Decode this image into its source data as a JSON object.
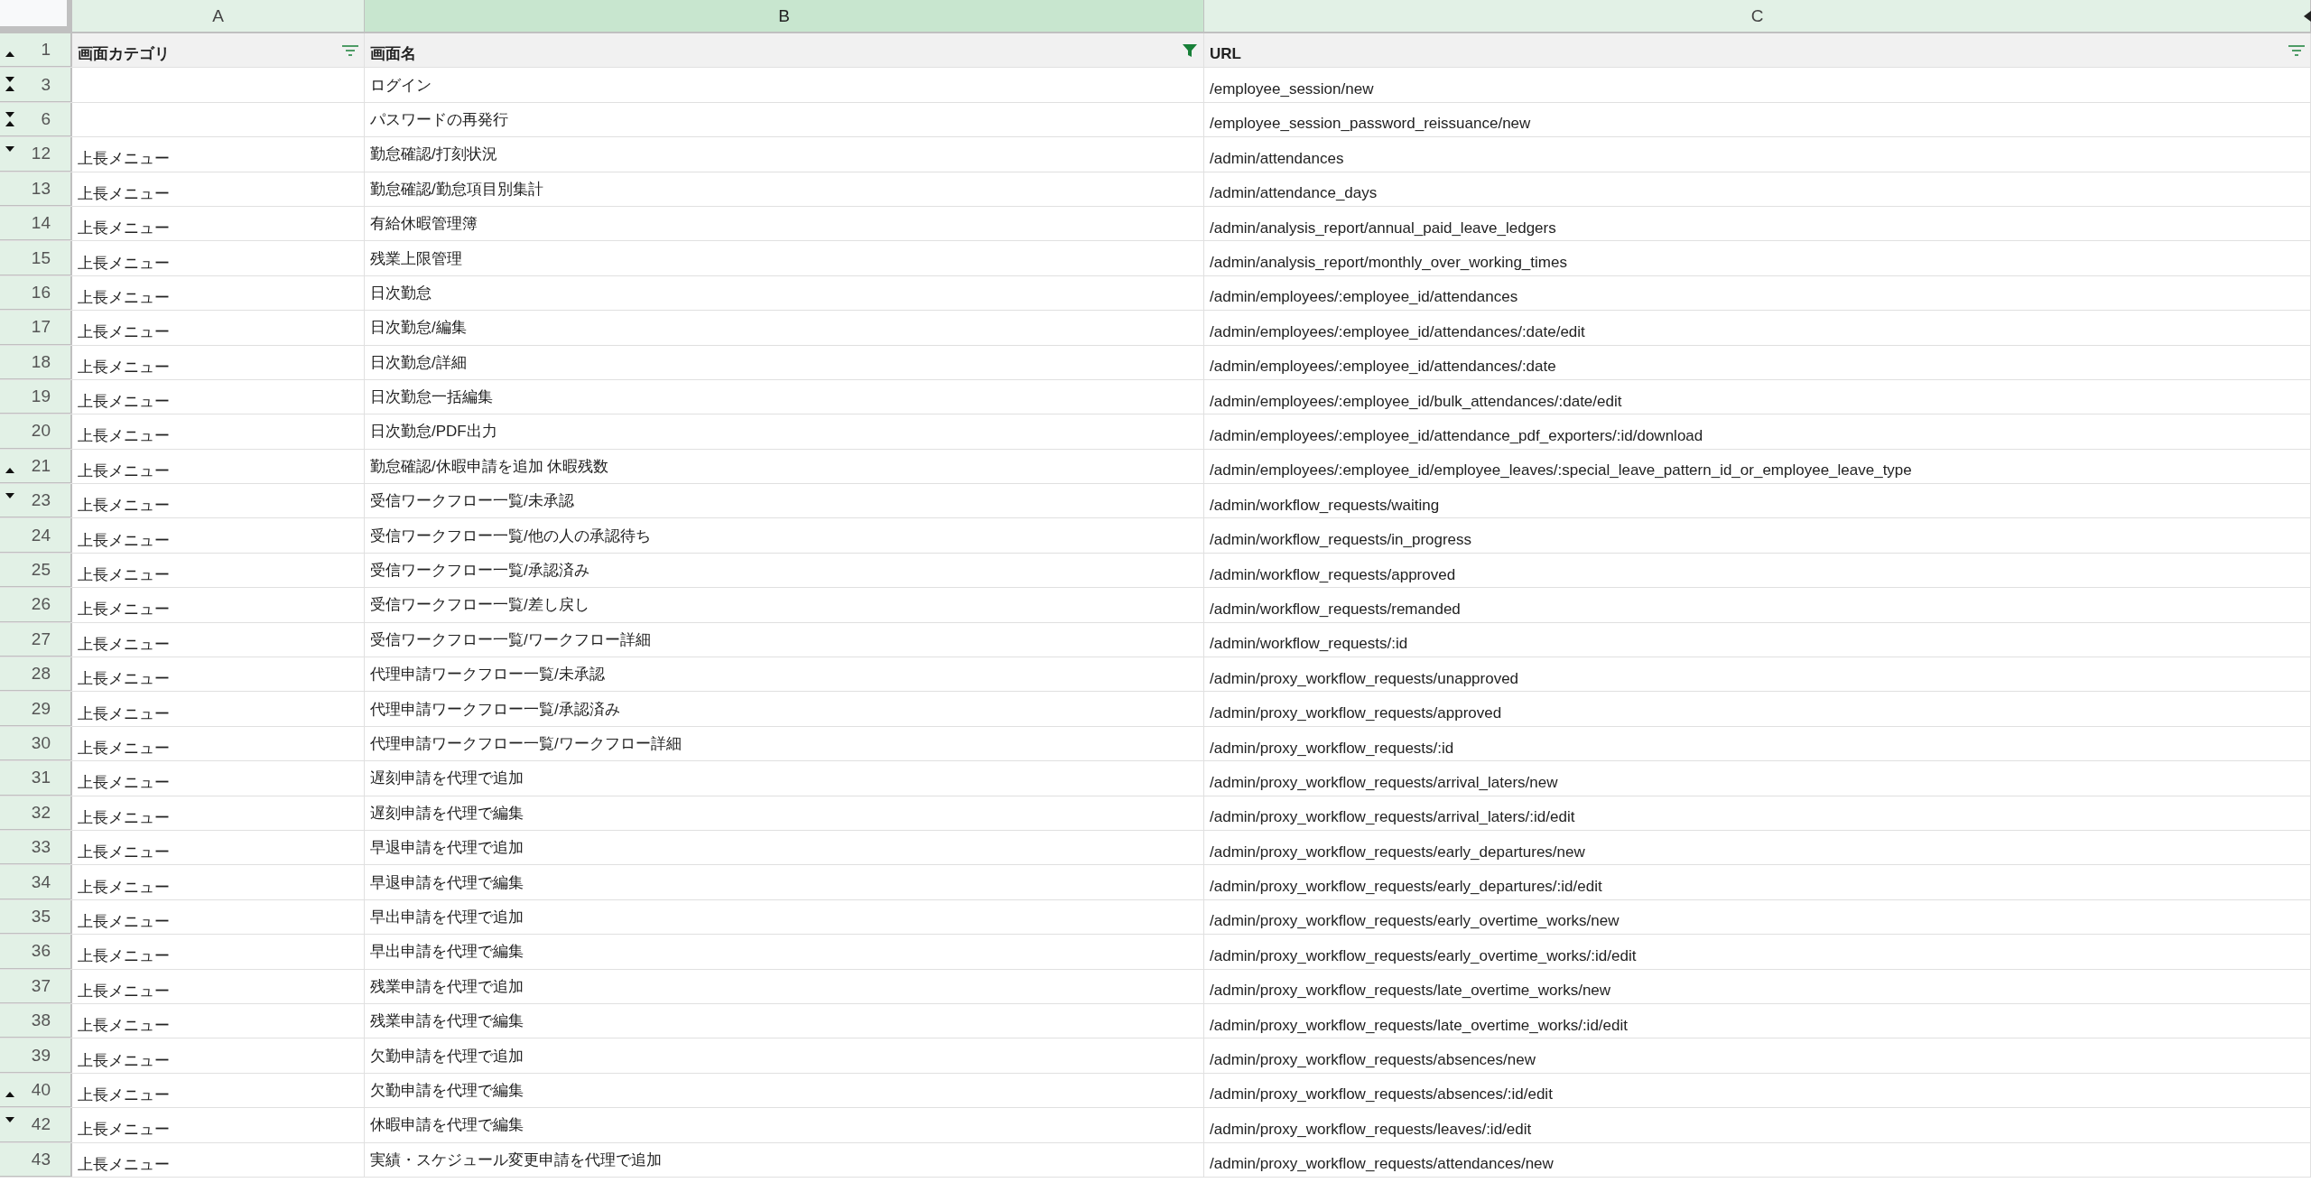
{
  "columns": [
    {
      "letter": "A",
      "selected": false
    },
    {
      "letter": "B",
      "selected": true
    },
    {
      "letter": "C",
      "selected": false
    }
  ],
  "header_row": {
    "number": "1",
    "arrow_up": true,
    "arrow_down": false,
    "cells": [
      {
        "text": "画面カテゴリ",
        "filter_active": false
      },
      {
        "text": "画面名",
        "filter_active": true
      },
      {
        "text": "URL",
        "filter_active": false
      }
    ]
  },
  "rows": [
    {
      "number": "3",
      "arrow_up": true,
      "arrow_down": true,
      "screen": "ログイン",
      "url": "/employee_session/new"
    },
    {
      "number": "6",
      "arrow_up": true,
      "arrow_down": true,
      "screen": "パスワードの再発行",
      "url": "/employee_session_password_reissuance/new"
    },
    {
      "number": "12",
      "arrow_up": false,
      "arrow_down": true,
      "category": "上長メニュー",
      "screen": "勤怠確認/打刻状況",
      "url": "/admin/attendances"
    },
    {
      "number": "13",
      "category": "上長メニュー",
      "screen": "勤怠確認/勤怠項目別集計",
      "url": "/admin/attendance_days"
    },
    {
      "number": "14",
      "category": "上長メニュー",
      "screen": "有給休暇管理簿",
      "url": "/admin/analysis_report/annual_paid_leave_ledgers"
    },
    {
      "number": "15",
      "category": "上長メニュー",
      "screen": "残業上限管理",
      "url": "/admin/analysis_report/monthly_over_working_times"
    },
    {
      "number": "16",
      "category": "上長メニュー",
      "screen": "日次勤怠",
      "url": "/admin/employees/:employee_id/attendances"
    },
    {
      "number": "17",
      "category": "上長メニュー",
      "screen": "日次勤怠/編集",
      "url": "/admin/employees/:employee_id/attendances/:date/edit"
    },
    {
      "number": "18",
      "category": "上長メニュー",
      "screen": "日次勤怠/詳細",
      "url": "/admin/employees/:employee_id/attendances/:date"
    },
    {
      "number": "19",
      "category": "上長メニュー",
      "screen": "日次勤怠一括編集",
      "url": "/admin/employees/:employee_id/bulk_attendances/:date/edit"
    },
    {
      "number": "20",
      "category": "上長メニュー",
      "screen": "日次勤怠/PDF出力",
      "url": "/admin/employees/:employee_id/attendance_pdf_exporters/:id/download"
    },
    {
      "number": "21",
      "arrow_up": true,
      "arrow_down": false,
      "category": "上長メニュー",
      "screen": "勤怠確認/休暇申請を追加 休暇残数",
      "url": "/admin/employees/:employee_id/employee_leaves/:special_leave_pattern_id_or_employee_leave_type"
    },
    {
      "number": "23",
      "arrow_up": false,
      "arrow_down": true,
      "category": "上長メニュー",
      "screen": "受信ワークフロー一覧/未承認",
      "url": "/admin/workflow_requests/waiting"
    },
    {
      "number": "24",
      "category": "上長メニュー",
      "screen": "受信ワークフロー一覧/他の人の承認待ち",
      "url": "/admin/workflow_requests/in_progress"
    },
    {
      "number": "25",
      "category": "上長メニュー",
      "screen": "受信ワークフロー一覧/承認済み",
      "url": "/admin/workflow_requests/approved"
    },
    {
      "number": "26",
      "category": "上長メニュー",
      "screen": "受信ワークフロー一覧/差し戻し",
      "url": "/admin/workflow_requests/remanded"
    },
    {
      "number": "27",
      "category": "上長メニュー",
      "screen": "受信ワークフロー一覧/ワークフロー詳細",
      "url": "/admin/workflow_requests/:id"
    },
    {
      "number": "28",
      "category": "上長メニュー",
      "screen": "代理申請ワークフロー一覧/未承認",
      "url": "/admin/proxy_workflow_requests/unapproved"
    },
    {
      "number": "29",
      "category": "上長メニュー",
      "screen": "代理申請ワークフロー一覧/承認済み",
      "url": "/admin/proxy_workflow_requests/approved"
    },
    {
      "number": "30",
      "category": "上長メニュー",
      "screen": "代理申請ワークフロー一覧/ワークフロー詳細",
      "url": "/admin/proxy_workflow_requests/:id"
    },
    {
      "number": "31",
      "category": "上長メニュー",
      "screen": "遅刻申請を代理で追加",
      "url": "/admin/proxy_workflow_requests/arrival_laters/new"
    },
    {
      "number": "32",
      "category": "上長メニュー",
      "screen": "遅刻申請を代理で編集",
      "url": "/admin/proxy_workflow_requests/arrival_laters/:id/edit"
    },
    {
      "number": "33",
      "category": "上長メニュー",
      "screen": "早退申請を代理で追加",
      "url": "/admin/proxy_workflow_requests/early_departures/new"
    },
    {
      "number": "34",
      "category": "上長メニュー",
      "screen": "早退申請を代理で編集",
      "url": "/admin/proxy_workflow_requests/early_departures/:id/edit"
    },
    {
      "number": "35",
      "category": "上長メニュー",
      "screen": "早出申請を代理で追加",
      "url": "/admin/proxy_workflow_requests/early_overtime_works/new"
    },
    {
      "number": "36",
      "category": "上長メニュー",
      "screen": "早出申請を代理で編集",
      "url": "/admin/proxy_workflow_requests/early_overtime_works/:id/edit"
    },
    {
      "number": "37",
      "category": "上長メニュー",
      "screen": "残業申請を代理で追加",
      "url": "/admin/proxy_workflow_requests/late_overtime_works/new"
    },
    {
      "number": "38",
      "category": "上長メニュー",
      "screen": "残業申請を代理で編集",
      "url": "/admin/proxy_workflow_requests/late_overtime_works/:id/edit"
    },
    {
      "number": "39",
      "category": "上長メニュー",
      "screen": "欠勤申請を代理で追加",
      "url": "/admin/proxy_workflow_requests/absences/new"
    },
    {
      "number": "40",
      "arrow_up": true,
      "arrow_down": false,
      "category": "上長メニュー",
      "screen": "欠勤申請を代理で編集",
      "url": "/admin/proxy_workflow_requests/absences/:id/edit"
    },
    {
      "number": "42",
      "arrow_up": false,
      "arrow_down": true,
      "category": "上長メニュー",
      "screen": "休暇申請を代理で編集",
      "url": "/admin/proxy_workflow_requests/leaves/:id/edit"
    },
    {
      "number": "43",
      "category": "上長メニュー",
      "screen": "実績・スケジュール変更申請を代理で追加",
      "url": "/admin/proxy_workflow_requests/attendances/new"
    }
  ]
}
